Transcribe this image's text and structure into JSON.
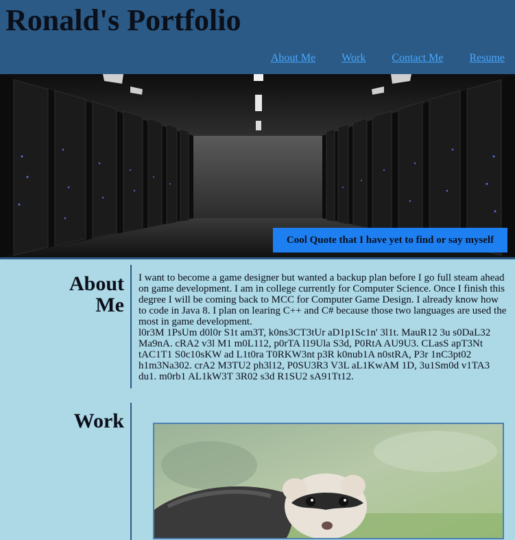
{
  "site": {
    "title": "Ronald's Portfolio"
  },
  "nav": {
    "items": [
      {
        "label": "About Me"
      },
      {
        "label": "Work"
      },
      {
        "label": "Contact Me"
      },
      {
        "label": "Resume"
      }
    ]
  },
  "hero": {
    "image": "server-room-photo",
    "quote": "Cool Quote that I have yet to find or say myself"
  },
  "about": {
    "heading_line1": "About",
    "heading_line2": "Me",
    "paragraph": "I want to become a game designer but wanted a backup plan before I go full steam ahead on game development. I am in college currently for Computer Science. Once I finish this degree I will be coming back to MCC for Computer Game Design. I already know how to code in Java 8. I plan on learing C++ and C# because those two languages are used the most in game development.",
    "filler": "l0r3M 1PsUm d0l0r S1t am3T, k0ns3CT3tUr aD1p1Sc1n' 3l1t. MauR12 3u s0DaL32 Ma9nA. cRA2 v3l M1 m0L112, p0rTA l19Ula S3d, P0RtA AU9U3. CLasS apT3Nt tAC1T1 S0c10sKW ad L1t0ra T0RKW3nt p3R k0nub1A n0stRA, P3r 1nC3pt02 h1m3Na302. crA2 M3TU2 ph3l12, P0SU3R3 V3L aL1KwAM 1D, 3u1Sm0d v1TA3 du1. m0rb1 AL1kW3T 3R02 s3d R1SU2 sA91Tt12."
  },
  "work": {
    "heading": "Work",
    "image": "ferret-photo"
  },
  "colors": {
    "header_bg": "#2a5a85",
    "page_bg": "#add8e6",
    "link": "#4aa8ff",
    "quote_bg": "#1e7ff0"
  }
}
